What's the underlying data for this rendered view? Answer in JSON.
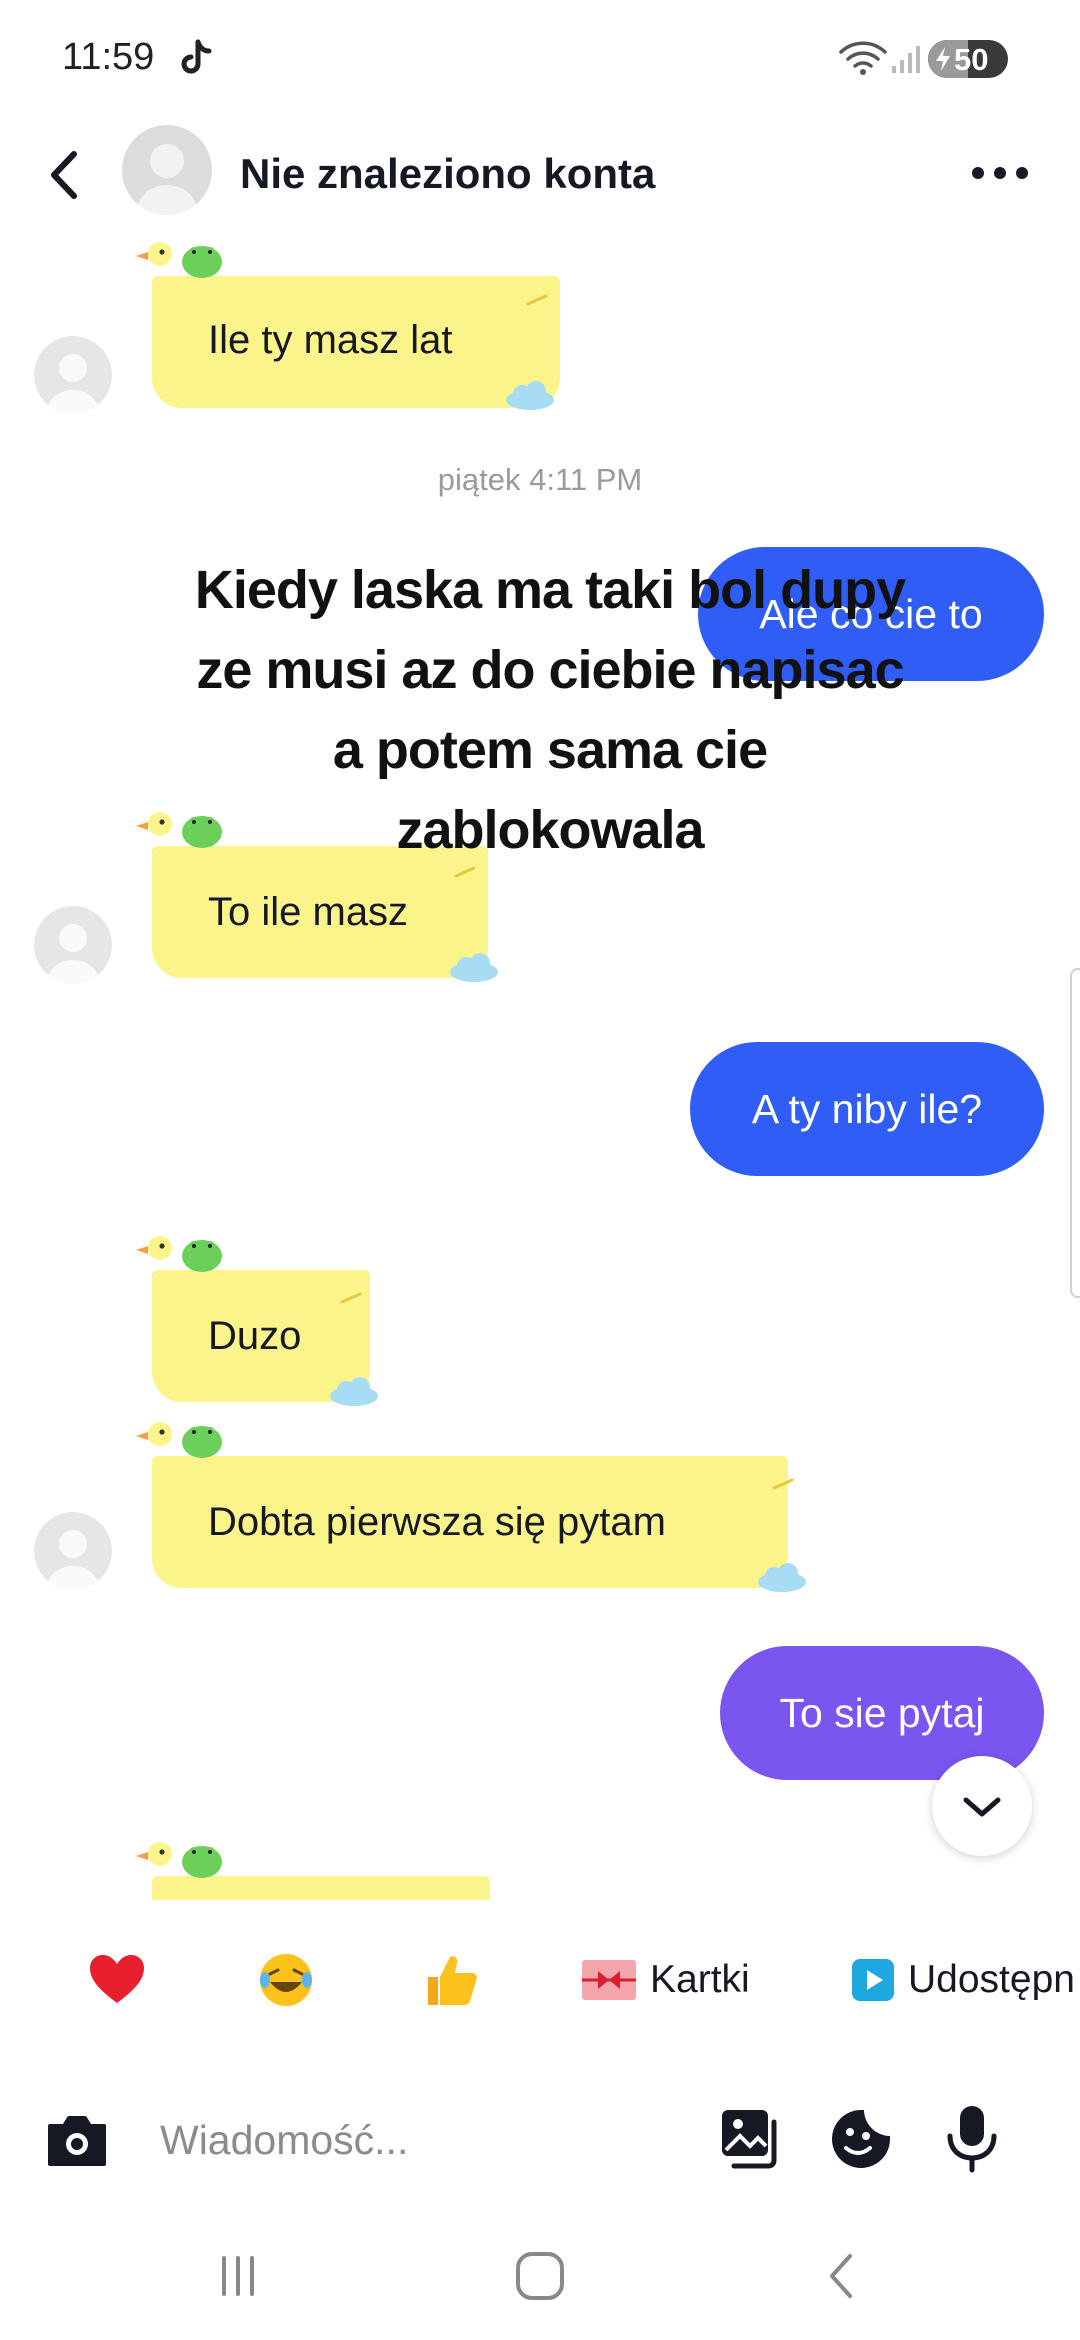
{
  "status_bar": {
    "time": "11:59",
    "battery": "50",
    "battery_level": 0.5
  },
  "header": {
    "title": "Nie znaleziono konta"
  },
  "overlay_caption": "Kiedy laska ma taki bol dupy ze musi az do ciebie napisac a potem sama cie zablokowala",
  "messages": [
    {
      "type": "received",
      "text": "Ile ty masz lat"
    },
    {
      "type": "timestamp",
      "text": "piątek 4:11 PM"
    },
    {
      "type": "sent",
      "text": "Ale co cie to"
    },
    {
      "type": "received",
      "text": "To ile masz"
    },
    {
      "type": "sent",
      "text": "A ty niby ile?"
    },
    {
      "type": "received",
      "text": "Duzo"
    },
    {
      "type": "received",
      "text": "Dobta pierwsza się pytam"
    },
    {
      "type": "sent",
      "text": "To sie pytaj"
    }
  ],
  "reactions": [
    {
      "emoji": "❤️",
      "icon": "heart-icon"
    },
    {
      "emoji": "😂",
      "icon": "laughing-icon"
    },
    {
      "emoji": "👍",
      "icon": "thumbs-up-icon"
    },
    {
      "label": "Kartki",
      "icon": "gift-card-icon"
    },
    {
      "label": "Udostępn",
      "icon": "share-play-icon"
    }
  ],
  "input": {
    "placeholder": "Wiadomość..."
  },
  "colors": {
    "received_bubble": "#fbf48a",
    "sent_blue": "#2f5df5",
    "sent_purple": "#7a55f0",
    "timestamp": "#9a9a9a"
  }
}
